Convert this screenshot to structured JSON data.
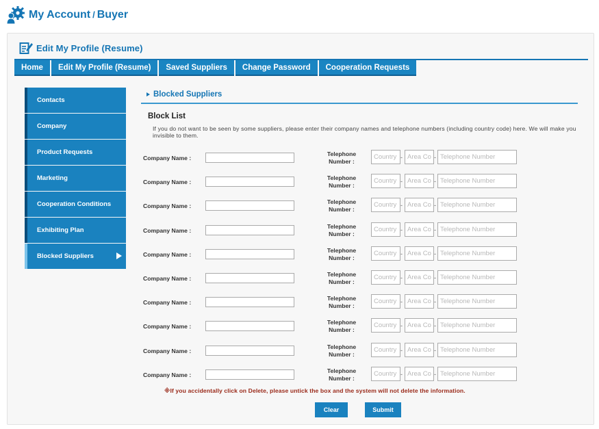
{
  "header": {
    "title_main": "My Account",
    "title_slash": "/",
    "title_sub": "Buyer",
    "icon": "gear-user-icon"
  },
  "panel": {
    "title": "Edit My Profile (Resume)",
    "icon": "edit-document-icon"
  },
  "tabs": [
    {
      "label": "Home"
    },
    {
      "label": "Edit My Profile (Resume)"
    },
    {
      "label": "Saved Suppliers"
    },
    {
      "label": "Change Password"
    },
    {
      "label": "Cooperation Requests"
    }
  ],
  "sidebar": {
    "items": [
      {
        "label": "Contacts"
      },
      {
        "label": "Company"
      },
      {
        "label": "Product Requests"
      },
      {
        "label": "Marketing"
      },
      {
        "label": "Cooperation Conditions"
      },
      {
        "label": "Exhibiting Plan"
      },
      {
        "label": "Blocked Suppliers",
        "active": true
      }
    ]
  },
  "section": {
    "heading": "Blocked Suppliers",
    "block_title": "Block List",
    "description": "If you do not want to be seen by some suppliers, please enter their company names and telephone numbers (including country code) here. We will make you invisible to them."
  },
  "form": {
    "company_label": "Company Name :",
    "phone_label_line1": "Telephone",
    "phone_label_line2": "Number :",
    "country_placeholder": "Country",
    "area_placeholder": "Area Code",
    "phone_placeholder": "Telephone Number",
    "separator": "-",
    "row_count": 10
  },
  "note": "※If you accidentally click on Delete, please untick the box and the system will not delete the information.",
  "buttons": {
    "clear": "Clear",
    "submit": "Submit"
  },
  "colors": {
    "accent": "#1475b4",
    "tab_bg": "#1a85c2",
    "sidebar_bg": "#1a82bf",
    "note": "#9a2a1a"
  }
}
